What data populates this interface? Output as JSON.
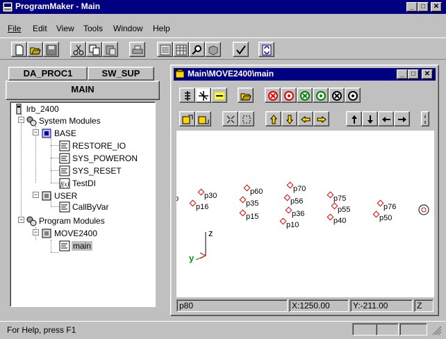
{
  "app": {
    "title": "ProgramMaker - Main"
  },
  "menu": {
    "items": [
      "File",
      "Edit",
      "View",
      "Tools",
      "Window",
      "Help"
    ]
  },
  "toolbar": {
    "icons": [
      "new-icon",
      "open-icon",
      "save-icon",
      "cut-icon",
      "copy-icon",
      "paste-icon",
      "print-icon",
      "form-icon",
      "grid-icon",
      "find-icon",
      "module-icon",
      "check-icon",
      "sync-icon"
    ]
  },
  "left_panel": {
    "tabs": [
      "DA_PROC1",
      "SW_SUP"
    ],
    "header": "MAIN",
    "tree": [
      {
        "label": "lrb_2400",
        "icon": "robot-icon"
      },
      {
        "label": "System Modules",
        "icon": "system-modules-icon"
      },
      {
        "label": "BASE",
        "icon": "module-icon"
      },
      {
        "label": "RESTORE_IO",
        "icon": "procedure-icon"
      },
      {
        "label": "SYS_POWERON",
        "icon": "procedure-icon"
      },
      {
        "label": "SYS_RESET",
        "icon": "procedure-icon"
      },
      {
        "label": "TestDI",
        "icon": "function-icon"
      },
      {
        "label": "USER",
        "icon": "module-icon"
      },
      {
        "label": "CallByVar",
        "icon": "procedure-icon"
      },
      {
        "label": "Program Modules",
        "icon": "program-modules-icon"
      },
      {
        "label": "MOVE2400",
        "icon": "module-icon"
      },
      {
        "label": "main",
        "icon": "procedure-icon",
        "selected": true
      }
    ]
  },
  "child_window": {
    "title": "Main\\MOVE2400\\main",
    "points": [
      "p30",
      "p16",
      "p60",
      "p35",
      "p15",
      "p70",
      "p56",
      "p36",
      "p10",
      "p75",
      "p55",
      "p40",
      "p76",
      "p50"
    ],
    "axis": {
      "z": "z",
      "y": "y"
    },
    "edge_label": "p",
    "status": {
      "point": "p80",
      "x": "X:1250.00",
      "y": "Y:-211.00",
      "z": "Z"
    }
  },
  "statusbar": {
    "text": "For Help, press F1"
  },
  "colors": {
    "titlebar": "#000080",
    "face": "#c0c0c0",
    "point": "#e00000"
  }
}
